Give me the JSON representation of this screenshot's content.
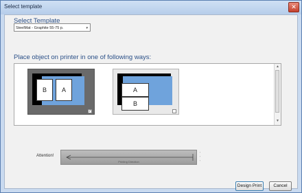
{
  "window": {
    "title": "Select template",
    "close_glyph": "✕"
  },
  "select_template": {
    "heading": "Select Template",
    "combo_value": "SteelMat - Graphite 55-75 p.",
    "combo_arrow": "▾"
  },
  "placement": {
    "heading": "Place object on printer in one of following ways:",
    "options": [
      {
        "labels": [
          "B",
          "A"
        ],
        "selected": true,
        "check": "✓"
      },
      {
        "labels": [
          "A",
          "B"
        ],
        "selected": false,
        "check": ""
      }
    ],
    "scroll_up": "▲",
    "scroll_down": "▼"
  },
  "attention": {
    "label": "Attention!",
    "direction_text": "Printing Direction",
    "side_marker": "◦ ◦ ◦"
  },
  "buttons": {
    "design_print": "Design Print",
    "cancel": "Cancel"
  },
  "colors": {
    "accent_blue": "#6fa3dc",
    "heading_blue": "#2a4f87"
  }
}
